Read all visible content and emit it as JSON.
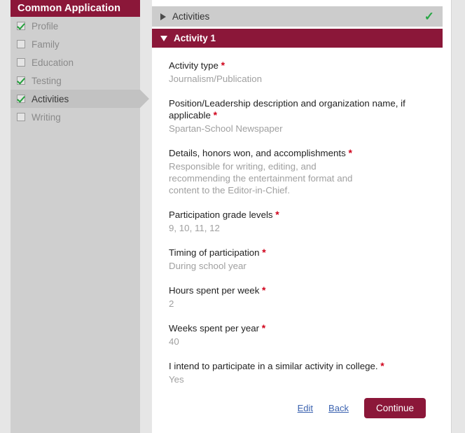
{
  "sidebar": {
    "title": "Common Application",
    "items": [
      {
        "label": "Profile",
        "checked": true,
        "selected": false
      },
      {
        "label": "Family",
        "checked": false,
        "selected": false
      },
      {
        "label": "Education",
        "checked": false,
        "selected": false
      },
      {
        "label": "Testing",
        "checked": true,
        "selected": false
      },
      {
        "label": "Activities",
        "checked": true,
        "selected": true
      },
      {
        "label": "Writing",
        "checked": false,
        "selected": false
      }
    ]
  },
  "main": {
    "section": {
      "label": "Activities",
      "collapse_icon": "triangle-right-icon",
      "status_icon": "green-check-icon",
      "status_glyph": "✓"
    },
    "activity": {
      "label": "Activity 1",
      "expand_icon": "triangle-down-icon"
    },
    "required_marker": "*",
    "fields": [
      {
        "label": "Activity type",
        "required": true,
        "value": "Journalism/Publication"
      },
      {
        "label": "Position/Leadership description and organization name, if applicable",
        "required": true,
        "value": "Spartan-School Newspaper"
      },
      {
        "label": "Details, honors won, and accomplishments",
        "required": true,
        "value": "Responsible for writing, editing, and\nrecommending the entertainment format and\ncontent to the Editor-in-Chief."
      },
      {
        "label": "Participation grade levels",
        "required": true,
        "value": "9, 10, 11, 12"
      },
      {
        "label": "Timing of participation",
        "required": true,
        "value": "During school year"
      },
      {
        "label": "Hours spent per week",
        "required": true,
        "value": "2"
      },
      {
        "label": "Weeks spent per year",
        "required": true,
        "value": "40"
      },
      {
        "label": "I intend to participate in a similar activity in college.",
        "required": true,
        "value": "Yes"
      }
    ],
    "actions": {
      "edit_label": "Edit",
      "back_label": "Back",
      "continue_label": "Continue"
    }
  },
  "colors": {
    "brand_maroon": "#8b1739",
    "sidebar_gray": "#cfcfcf",
    "selected_gray": "#c2c2c2",
    "header_gray": "#cccccc",
    "page_gray": "#e6e6e6",
    "check_green": "#28a745",
    "required_red": "#d0021b",
    "link_blue": "#3c63b0",
    "value_gray": "#a0a0a0"
  }
}
